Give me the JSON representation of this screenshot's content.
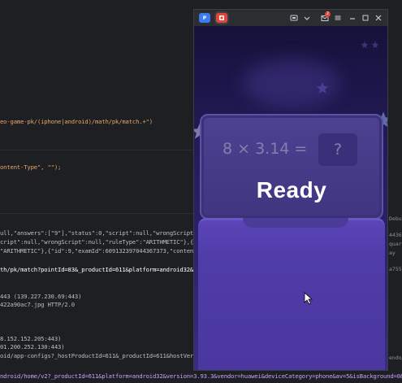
{
  "editor": {
    "lines": [
      {
        "text": "eo-game-pk/(iphone|android)/math/pk/match.+\")",
        "style": "orange"
      },
      {
        "text": "ontent-Type\", \"\");",
        "style": "orange"
      },
      {
        "text": "ull,\"answers\":[\"9\"],\"status\":0,\"script\":null,\"wrongScript\"",
        "style": "normal"
      },
      {
        "text": "cript\":null,\"wrongScript\":null,\"ruleType\":\"ARITHMETIC\"},{",
        "style": "normal"
      },
      {
        "text": "\"ARITHMETIC\"},{\"id\":9,\"examId\":609132397044367373,\"conten",
        "style": "normal"
      },
      {
        "text": "th/pk/match?pointId=83&_productId=611&platform=android32&v",
        "style": "white"
      },
      {
        "text": "443 (139.227.230.69:443)",
        "style": "normal"
      },
      {
        "text": "422a90ac7.jpg HTTP/2.0",
        "style": "normal"
      },
      {
        "text": "8.152.152.205:443)",
        "style": "normal"
      },
      {
        "text": "01.200.252.130:443)",
        "style": "normal"
      },
      {
        "text": "oid/app-configs?_hostProductId=611&_productId=611&hostVersi",
        "style": "normal"
      },
      {
        "text": "ndroid/home/v2?_productId=611&platform=android32&version=3.93.3&vendor=huawei&deviceCategory=phone&av=5&isBackground=0&",
        "style": "purple"
      }
    ],
    "right_snippets": [
      "Debug",
      "4436",
      "quar",
      "ay",
      "a755",
      "endo"
    ]
  },
  "emulator": {
    "tabs": [
      {
        "label": "P",
        "color": "#3b7bf0"
      },
      {
        "label": "",
        "color": "#e0453a"
      }
    ],
    "controls": [
      {
        "name": "screen-mirror-icon"
      },
      {
        "name": "chevron-down-icon"
      },
      {
        "name": "mail-icon",
        "badge": "2"
      },
      {
        "name": "menu-icon"
      },
      {
        "name": "minimize-icon"
      },
      {
        "name": "maximize-icon"
      },
      {
        "name": "close-icon"
      }
    ]
  },
  "game": {
    "question": "8 × 3.14 =",
    "answer_placeholder": "?",
    "status": "Ready"
  }
}
